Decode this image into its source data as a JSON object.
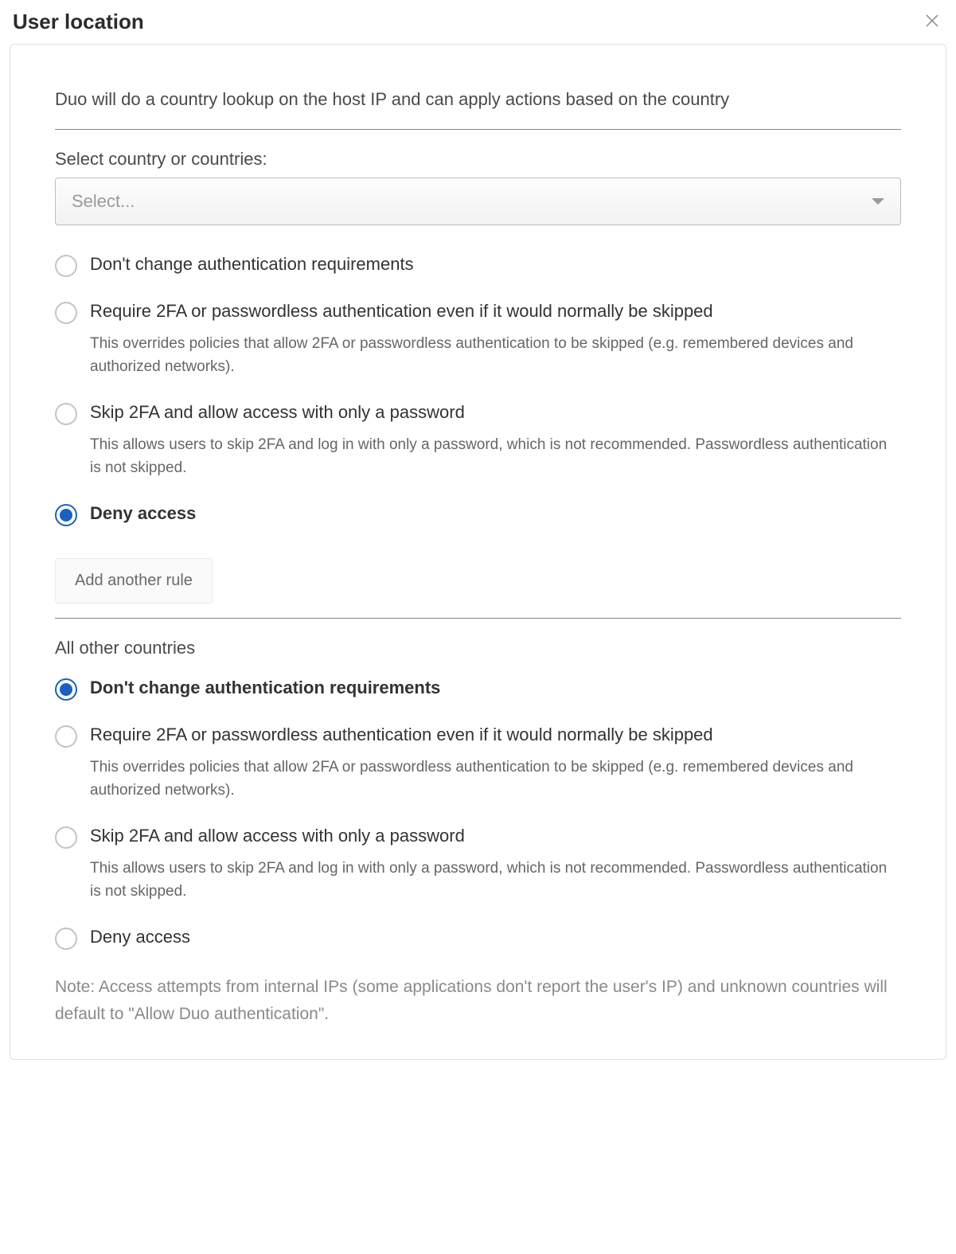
{
  "header": {
    "title": "User location"
  },
  "panel": {
    "description": "Duo will do a country lookup on the host IP and can apply actions based on the country",
    "selectLabel": "Select country or countries:",
    "selectPlaceholder": "Select...",
    "rule1": {
      "options": [
        {
          "label": "Don't change authentication requirements",
          "help": null,
          "selected": false
        },
        {
          "label": "Require 2FA or passwordless authentication even if it would normally be skipped",
          "help": "This overrides policies that allow 2FA or passwordless authentication to be skipped (e.g. remembered devices and authorized networks).",
          "selected": false
        },
        {
          "label": "Skip 2FA and allow access with only a password",
          "help": "This allows users to skip 2FA and log in with only a password, which is not recommended. Passwordless authentication is not skipped.",
          "selected": false
        },
        {
          "label": "Deny access",
          "help": null,
          "selected": true
        }
      ]
    },
    "addRuleLabel": "Add another rule",
    "otherCountriesLabel": "All other countries",
    "rule2": {
      "options": [
        {
          "label": "Don't change authentication requirements",
          "help": null,
          "selected": true
        },
        {
          "label": "Require 2FA or passwordless authentication even if it would normally be skipped",
          "help": "This overrides policies that allow 2FA or passwordless authentication to be skipped (e.g. remembered devices and authorized networks).",
          "selected": false
        },
        {
          "label": "Skip 2FA and allow access with only a password",
          "help": "This allows users to skip 2FA and log in with only a password, which is not recommended. Passwordless authentication is not skipped.",
          "selected": false
        },
        {
          "label": "Deny access",
          "help": null,
          "selected": false
        }
      ]
    },
    "note": "Note: Access attempts from internal IPs (some applications don't report the user's IP) and unknown countries will default to \"Allow Duo authentication\"."
  }
}
